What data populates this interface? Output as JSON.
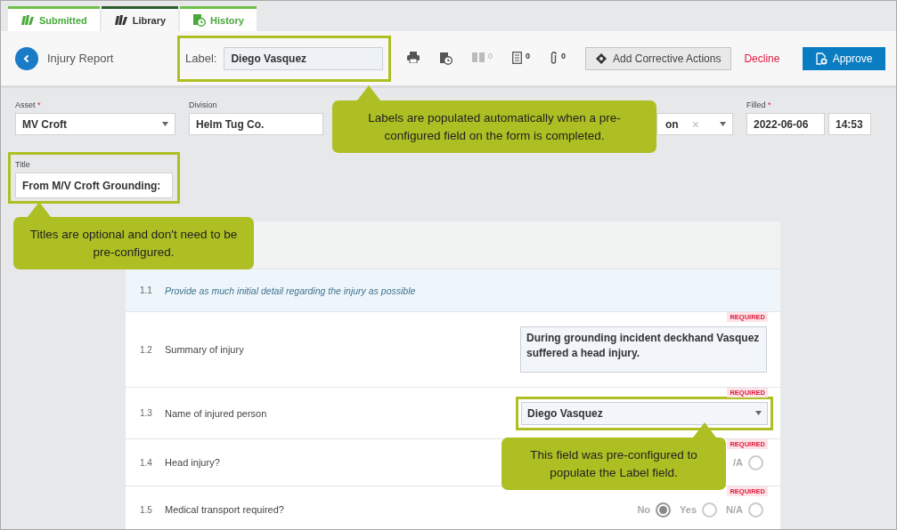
{
  "tabs": [
    {
      "label": "Submitted",
      "kind": "books",
      "selected": false
    },
    {
      "label": "Library",
      "kind": "books",
      "selected": true
    },
    {
      "label": "History",
      "kind": "history",
      "selected": false
    }
  ],
  "toolbar": {
    "title": "Injury Report",
    "label_field": {
      "caption": "Label:",
      "value": "Diego Vasquez",
      "highlighted": true
    },
    "icons": [
      {
        "kind": "printer",
        "disabled": false
      },
      {
        "kind": "history",
        "disabled": false
      },
      {
        "kind": "book",
        "count": "0",
        "disabled": true
      },
      {
        "kind": "document",
        "count": "0",
        "disabled": false
      },
      {
        "kind": "paperclip",
        "count": "0",
        "disabled": false
      }
    ],
    "corrective_button": "Add Corrective Actions",
    "decline_button": "Decline",
    "approve_button": "Approve"
  },
  "header_fields": {
    "asset": {
      "label": "Asset",
      "required_mark": "*",
      "value": "MV Croft"
    },
    "division": {
      "label": "Division",
      "value": "Helm Tug Co."
    },
    "covered_field": {
      "value": "on"
    },
    "filled": {
      "label": "Filled",
      "required_mark": "*",
      "date": "2022-06-06",
      "time": "14:53"
    },
    "title": {
      "label": "Title",
      "value": "From M/V Croft Grounding:",
      "highlighted": true
    }
  },
  "form_rows": [
    {
      "number": "1.1",
      "kind": "instruction",
      "text": "Provide as much initial detail regarding the injury as possible"
    },
    {
      "number": "1.2",
      "kind": "textarea",
      "text": "Summary of injury",
      "badge": "REQUIRED",
      "value": "During grounding incident deckhand Vasquez suffered a head injury."
    },
    {
      "number": "1.3",
      "kind": "select",
      "text": "Name of injured person",
      "badge": "REQUIRED",
      "value": "Diego Vasquez",
      "highlighted": true
    },
    {
      "number": "1.4",
      "kind": "radio",
      "text": "Head injury?",
      "badge": "REQUIRED",
      "options": [
        {
          "label": "/A",
          "selected": false
        }
      ]
    },
    {
      "number": "1.5",
      "kind": "radio",
      "text": "Medical transport required?",
      "badge": "REQUIRED",
      "options": [
        {
          "label": "No",
          "selected": true
        },
        {
          "label": "Yes",
          "selected": false
        },
        {
          "label": "N/A",
          "selected": false
        }
      ]
    }
  ],
  "callouts": [
    "Labels are populated automatically when a pre-configured field on the form is completed.",
    "Titles are optional and don't need to be pre-configured.",
    "This field was pre-configured to populate the Label field."
  ]
}
